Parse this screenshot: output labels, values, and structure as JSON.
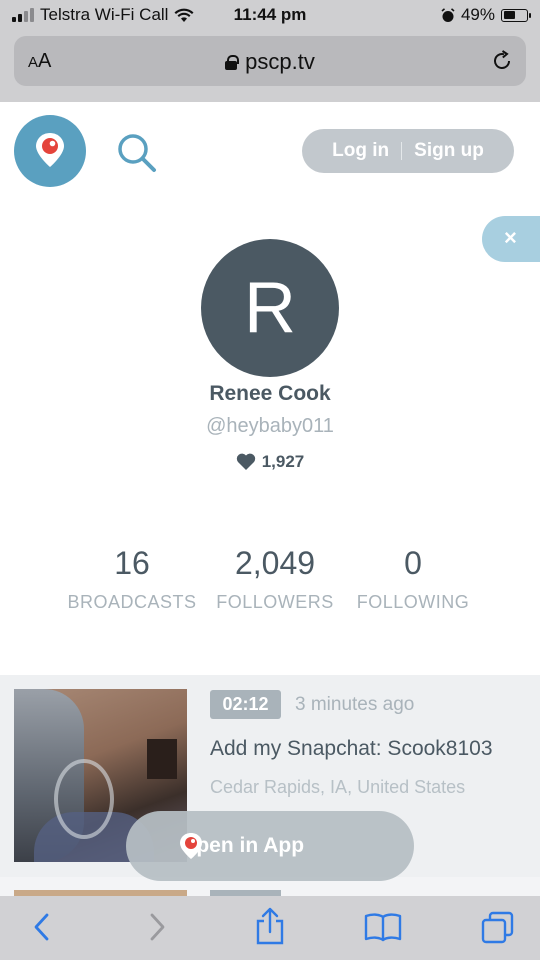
{
  "status_bar": {
    "carrier": "Telstra Wi-Fi Call",
    "time": "11:44 pm",
    "battery": "49%",
    "battery_level": 0.49
  },
  "browser": {
    "text_size_label": "AA",
    "domain": "pscp.tv"
  },
  "header": {
    "login_label": "Log in",
    "signup_label": "Sign up",
    "close_label": "×"
  },
  "profile": {
    "avatar_initial": "R",
    "name": "Renee Cook",
    "handle": "@heybaby011",
    "hearts": "1,927"
  },
  "stats": [
    {
      "value": "16",
      "label": "BROADCASTS"
    },
    {
      "value": "2,049",
      "label": "FOLLOWERS"
    },
    {
      "value": "0",
      "label": "FOLLOWING"
    }
  ],
  "broadcast": {
    "duration": "02:12",
    "time_ago": "3 minutes ago",
    "title": "Add my Snapchat: Scook8103",
    "location": "Cedar Rapids, IA, United States"
  },
  "open_app": {
    "label": "Open in App"
  },
  "colors": {
    "brand": "#5aa0c0",
    "text": "#4b5963",
    "muted": "#a9b3ba"
  },
  "icons": [
    "wifi-icon",
    "alarm-icon",
    "lock-icon",
    "reload-icon",
    "periscope-logo",
    "search-icon",
    "heart-icon",
    "back-icon",
    "forward-icon",
    "share-icon",
    "bookmarks-icon",
    "tabs-icon"
  ]
}
